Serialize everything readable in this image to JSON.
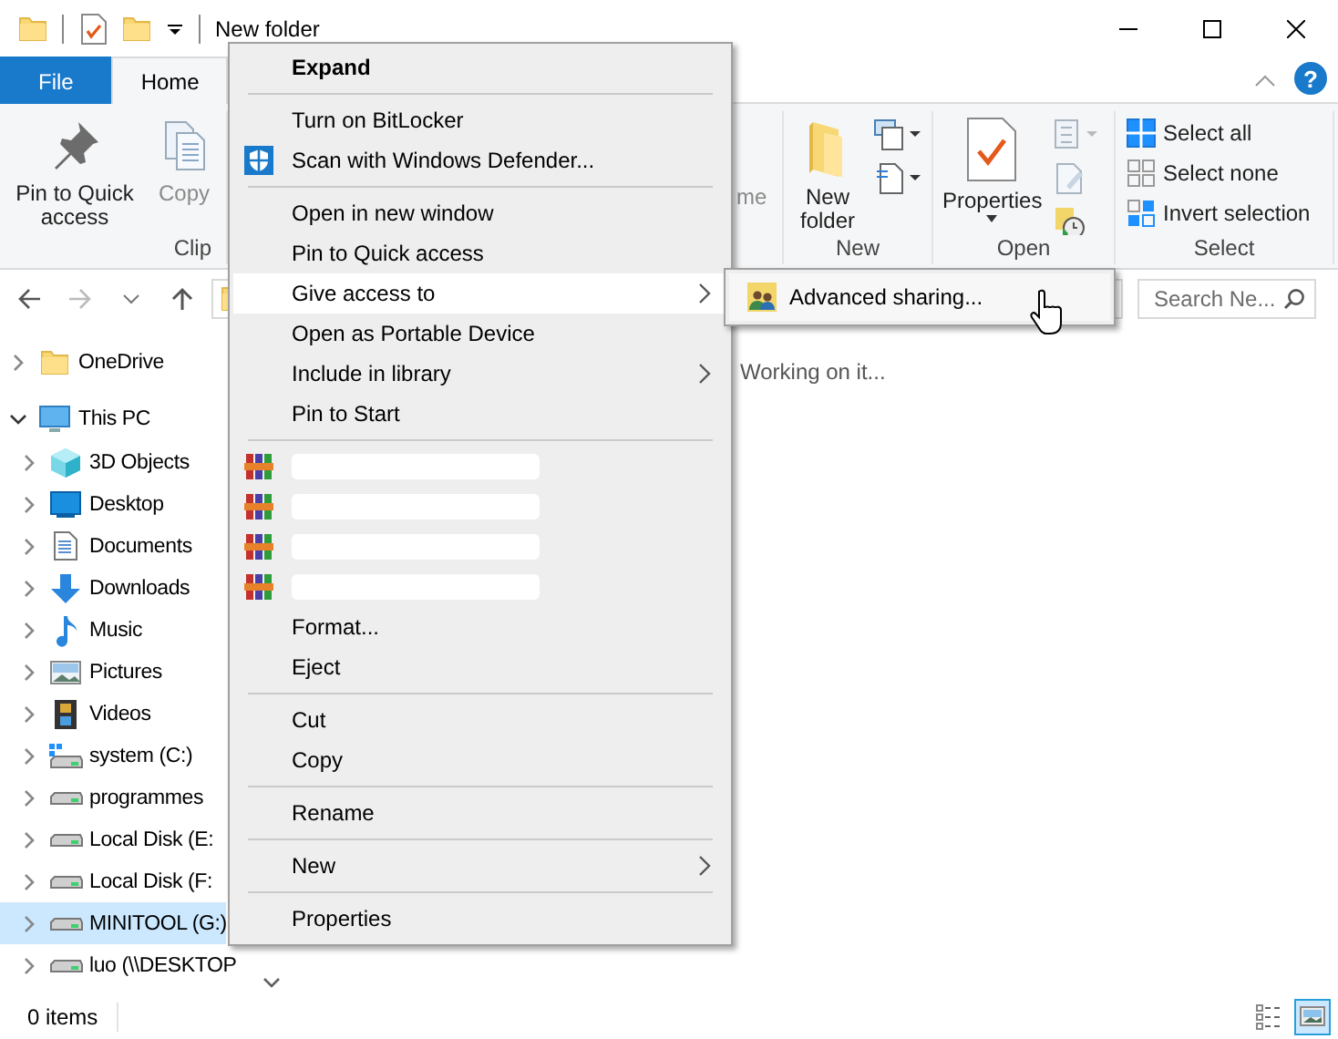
{
  "title_bar": {
    "title": "New folder"
  },
  "ribbon": {
    "tabs": [
      {
        "label": "File",
        "kind": "file",
        "selected": false
      },
      {
        "label": "Home",
        "kind": "tab",
        "selected": true
      }
    ],
    "help": "?",
    "groups": [
      {
        "label": "Clip",
        "commands": [
          {
            "label": "Pin to Quick access",
            "kind": "pin",
            "disabled": false
          },
          {
            "label": "Copy",
            "kind": "copy",
            "disabled": true
          }
        ]
      },
      {
        "commands": [
          {
            "label": "me",
            "kind": "fragment",
            "disabled": true
          }
        ]
      },
      {
        "label": "New",
        "commands": [
          {
            "label": "New folder",
            "kind": "new-folder",
            "disabled": false
          }
        ]
      },
      {
        "label": "Open",
        "commands": [
          {
            "label": "Properties",
            "kind": "properties",
            "disabled": false
          }
        ]
      },
      {
        "label": "Select",
        "commands": [
          {
            "label": "Select all",
            "kind": "select-all",
            "disabled": false
          },
          {
            "label": "Select none",
            "kind": "select-none",
            "disabled": false
          },
          {
            "label": "Invert selection",
            "kind": "invert-selection",
            "disabled": false
          }
        ]
      }
    ]
  },
  "address_bar": {
    "search": {
      "placeholder": "Search Ne..."
    }
  },
  "navigation_pane": {
    "tree": [
      {
        "label": "OneDrive",
        "kind": "folder",
        "expanded": false,
        "selected": false
      },
      {
        "label": "This PC",
        "kind": "pc",
        "expanded": true,
        "selected": false,
        "children": [
          {
            "label": "3D Objects",
            "kind": "cube",
            "expanded": false,
            "selected": false
          },
          {
            "label": "Desktop",
            "kind": "desktop",
            "expanded": false,
            "selected": false
          },
          {
            "label": "Documents",
            "kind": "documents",
            "expanded": false,
            "selected": false
          },
          {
            "label": "Downloads",
            "kind": "downloads",
            "expanded": false,
            "selected": false
          },
          {
            "label": "Music",
            "kind": "music",
            "expanded": false,
            "selected": false
          },
          {
            "label": "Pictures",
            "kind": "pictures",
            "expanded": false,
            "selected": false
          },
          {
            "label": "Videos",
            "kind": "videos",
            "expanded": false,
            "selected": false
          },
          {
            "label": "system (C:)",
            "kind": "system-drive",
            "expanded": false,
            "selected": false
          },
          {
            "label": "programmes",
            "kind": "drive",
            "expanded": false,
            "selected": false
          },
          {
            "label": "Local Disk (E:",
            "kind": "drive",
            "expanded": false,
            "selected": false
          },
          {
            "label": "Local Disk (F:",
            "kind": "drive",
            "expanded": false,
            "selected": false
          },
          {
            "label": "MINITOOL (G:)",
            "kind": "drive",
            "expanded": false,
            "selected": true
          },
          {
            "label": "luo (\\\\DESKTOP",
            "kind": "drive",
            "expanded": false,
            "selected": false
          }
        ]
      }
    ]
  },
  "content": {
    "message": "Working on it..."
  },
  "status_bar": {
    "item_count": "0 items",
    "views": [
      {
        "kind": "details",
        "selected": false
      },
      {
        "kind": "large-icons",
        "selected": true
      }
    ]
  },
  "context_menu": {
    "items": [
      {
        "kind": "command",
        "label": "Expand",
        "default": true
      },
      {
        "kind": "separator"
      },
      {
        "kind": "command",
        "label": "Turn on BitLocker"
      },
      {
        "kind": "security-command",
        "label": "Scan with Windows Defender..."
      },
      {
        "kind": "separator"
      },
      {
        "kind": "command",
        "label": "Open in new window"
      },
      {
        "kind": "command",
        "label": "Pin to Quick access"
      },
      {
        "kind": "command",
        "label": "Give access to",
        "submenu": true,
        "selected": true
      },
      {
        "kind": "command",
        "label": "Open as Portable Device"
      },
      {
        "kind": "command",
        "label": "Include in library",
        "submenu": true
      },
      {
        "kind": "command",
        "label": "Pin to Start"
      },
      {
        "kind": "separator"
      },
      {
        "kind": "redacted"
      },
      {
        "kind": "redacted"
      },
      {
        "kind": "redacted"
      },
      {
        "kind": "redacted"
      },
      {
        "kind": "command",
        "label": "Format..."
      },
      {
        "kind": "command",
        "label": "Eject"
      },
      {
        "kind": "separator"
      },
      {
        "kind": "command",
        "label": "Cut"
      },
      {
        "kind": "command",
        "label": "Copy"
      },
      {
        "kind": "separator"
      },
      {
        "kind": "command",
        "label": "Rename"
      },
      {
        "kind": "separator"
      },
      {
        "kind": "command",
        "label": "New",
        "submenu": true
      },
      {
        "kind": "separator"
      },
      {
        "kind": "command",
        "label": "Properties"
      }
    ]
  },
  "submenu": {
    "items": [
      {
        "label": "Advanced sharing...",
        "kind": "sharing"
      }
    ]
  }
}
